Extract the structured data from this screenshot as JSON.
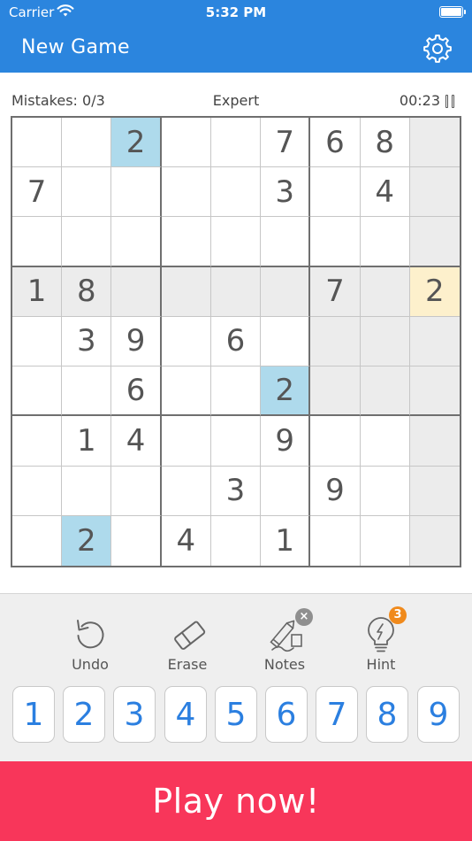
{
  "status_bar": {
    "carrier": "Carrier",
    "time": "5:32 PM"
  },
  "header": {
    "title": "New Game",
    "settings_icon": "gear-icon"
  },
  "game_info": {
    "mistakes": "Mistakes: 0/3",
    "difficulty": "Expert",
    "timer": "00:23"
  },
  "board": {
    "cells": [
      [
        "",
        "",
        "2",
        "",
        "",
        "7",
        "6",
        "8",
        ""
      ],
      [
        "7",
        "",
        "",
        "",
        "",
        "3",
        "",
        "4",
        ""
      ],
      [
        "",
        "",
        "",
        "",
        "",
        "",
        "",
        "",
        ""
      ],
      [
        "1",
        "8",
        "",
        "",
        "",
        "",
        "7",
        "",
        "2"
      ],
      [
        "",
        "3",
        "9",
        "",
        "6",
        "",
        "",
        "",
        ""
      ],
      [
        "",
        "",
        "6",
        "",
        "",
        "2",
        "",
        "",
        ""
      ],
      [
        "",
        "1",
        "4",
        "",
        "",
        "9",
        "",
        "",
        ""
      ],
      [
        "",
        "",
        "",
        "",
        "3",
        "",
        "9",
        "",
        ""
      ],
      [
        "",
        "2",
        "",
        "4",
        "",
        "1",
        "",
        "",
        ""
      ]
    ],
    "highlight_gray": [
      [
        0,
        8
      ],
      [
        1,
        8
      ],
      [
        2,
        8
      ],
      [
        3,
        0
      ],
      [
        3,
        1
      ],
      [
        3,
        2
      ],
      [
        3,
        3
      ],
      [
        3,
        4
      ],
      [
        3,
        5
      ],
      [
        3,
        6
      ],
      [
        3,
        7
      ],
      [
        4,
        6
      ],
      [
        4,
        7
      ],
      [
        4,
        8
      ],
      [
        5,
        6
      ],
      [
        5,
        7
      ],
      [
        5,
        8
      ],
      [
        6,
        8
      ],
      [
        7,
        8
      ],
      [
        8,
        8
      ]
    ],
    "highlight_blue": [
      [
        0,
        2
      ],
      [
        5,
        5
      ],
      [
        8,
        1
      ]
    ],
    "selected_cell": [
      3,
      8
    ],
    "colors": {
      "grid_line": "#c6c6c6",
      "box_line": "#6f6f6f",
      "gray": "#ececec",
      "blue": "#aedaec",
      "selected": "#fdf0cc",
      "digit": "#555555"
    }
  },
  "tools": {
    "undo": {
      "label": "Undo",
      "icon": "undo-icon"
    },
    "erase": {
      "label": "Erase",
      "icon": "eraser-icon"
    },
    "notes": {
      "label": "Notes",
      "icon": "pencil-icon",
      "badge": "×"
    },
    "hint": {
      "label": "Hint",
      "icon": "lightbulb-icon",
      "badge": "3"
    }
  },
  "numpad": [
    "1",
    "2",
    "3",
    "4",
    "5",
    "6",
    "7",
    "8",
    "9"
  ],
  "cta": {
    "label": "Play now!",
    "color": "#f8365a"
  },
  "theme": {
    "primary": "#2b85de",
    "number_blue": "#2b7fe0",
    "hint_badge": "#f08a1c"
  }
}
